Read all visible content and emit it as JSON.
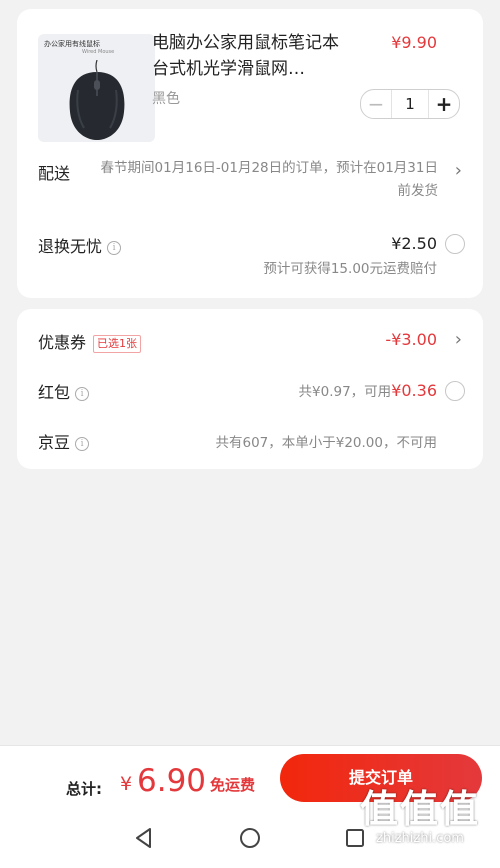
{
  "product": {
    "image_caption": "办公家用有线鼠标",
    "image_subcaption": "Wired Mouse",
    "title": "电脑办公家用鼠标笔记本台式机光学滑鼠网…",
    "price": "¥9.90",
    "variant": "黑色",
    "quantity": "1",
    "minus_glyph": "−",
    "plus_glyph": "+"
  },
  "delivery": {
    "label": "配送",
    "text": "春节期间01月16日-01月28日的订单，预计在01月31日前发货"
  },
  "return_service": {
    "label": "退换无忧",
    "price": "¥2.50",
    "subtext": "预计可获得15.00元运费赔付"
  },
  "coupon": {
    "label": "优惠券",
    "badge": "已选1张",
    "value": "-¥3.00"
  },
  "red_packet": {
    "label": "红包",
    "total": "共¥0.97，可用",
    "usable": "¥0.36"
  },
  "jingdou": {
    "label": "京豆",
    "text": "共有607，本单小于¥20.00，不可用"
  },
  "footer": {
    "total_label": "总计:",
    "currency": "¥",
    "total_value": "6.90",
    "shipping": "免运费",
    "submit_label": "提交订单"
  },
  "watermark": {
    "glyphs": "值值值",
    "url": "zhizhizhi.com"
  },
  "icons": {
    "info": "info-icon",
    "chevron": "chevron-right-icon",
    "back": "back-icon",
    "home": "home-icon",
    "recents": "recents-icon"
  },
  "colors": {
    "accent": "#e4393c",
    "background": "#f2f2f2"
  }
}
